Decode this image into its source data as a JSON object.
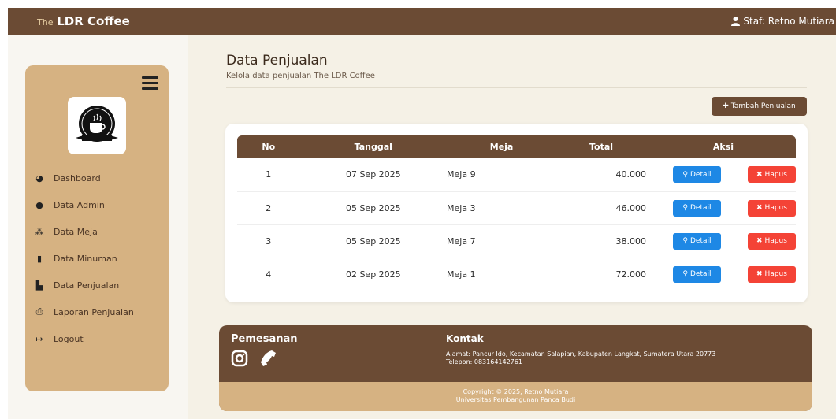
{
  "header": {
    "brand_prefix": "The",
    "brand_name": "LDR Coffee",
    "staff_label": "Staf: Retno Mutiara"
  },
  "sidebar": {
    "items": [
      {
        "label": "Dashboard",
        "icon": "tachometer-icon"
      },
      {
        "label": "Data Admin",
        "icon": "user-icon"
      },
      {
        "label": "Data Meja",
        "icon": "users-icon"
      },
      {
        "label": "Data Minuman",
        "icon": "cup-icon"
      },
      {
        "label": "Data Penjualan",
        "icon": "cash-register-icon"
      },
      {
        "label": "Laporan Penjualan",
        "icon": "print-icon"
      },
      {
        "label": "Logout",
        "icon": "sign-out-icon"
      }
    ]
  },
  "main": {
    "title": "Data Penjualan",
    "subtitle": "Kelola data penjualan The LDR Coffee",
    "add_button": "Tambah Penjualan",
    "columns": [
      "No",
      "Tanggal",
      "Meja",
      "Total",
      "Aksi"
    ],
    "rows": [
      {
        "no": "1",
        "tanggal": "07 Sep 2025",
        "meja": "Meja 9",
        "total": "40.000"
      },
      {
        "no": "2",
        "tanggal": "05 Sep 2025",
        "meja": "Meja 3",
        "total": "46.000"
      },
      {
        "no": "3",
        "tanggal": "05 Sep 2025",
        "meja": "Meja 7",
        "total": "38.000"
      },
      {
        "no": "4",
        "tanggal": "02 Sep 2025",
        "meja": "Meja 1",
        "total": "72.000"
      }
    ],
    "detail_label": "Detail",
    "hapus_label": "Hapus"
  },
  "footer": {
    "pemesanan": "Pemesanan",
    "kontak": "Kontak",
    "alamat": "Alamat: Pancur Ido, Kecamatan Salapian, Kabupaten Langkat, Sumatera Utara 20773",
    "telepon": "Telepon: 083164142761",
    "copyright": "Copyright © 2025, Retno Mutiara",
    "university": "Universitas Pembangunan Panca Budi"
  },
  "colors": {
    "brown": "#6b4b34",
    "tan": "#d6b282",
    "detail_blue": "#1e88e5",
    "hapus_red": "#f44336"
  }
}
